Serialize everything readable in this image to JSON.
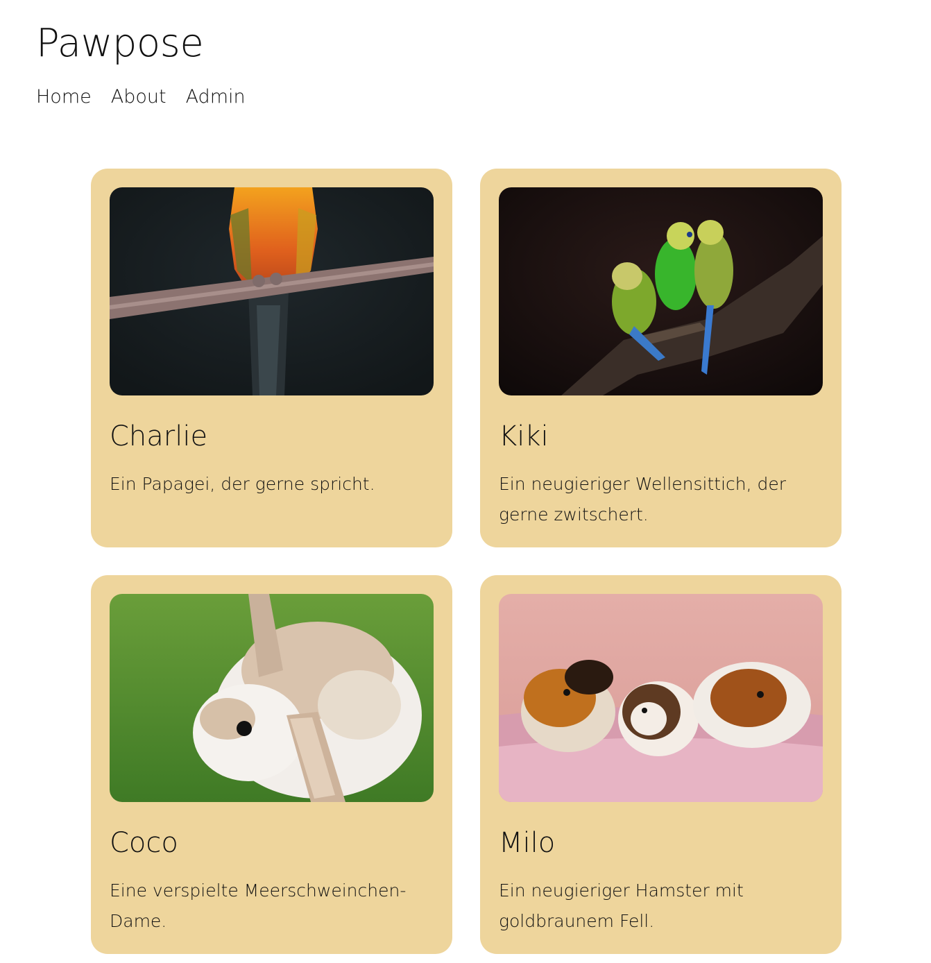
{
  "header": {
    "title": "Pawpose",
    "nav": [
      "Home",
      "About",
      "Admin"
    ]
  },
  "pets": [
    {
      "name": "Charlie",
      "description": "Ein Papagei, der gerne spricht.",
      "photo_icon": "parrot-photo"
    },
    {
      "name": "Kiki",
      "description": "Ein neugieriger Wellensittich, der gerne zwitschert.",
      "photo_icon": "budgies-photo"
    },
    {
      "name": "Coco",
      "description": "Eine verspielte Meerschweinchen-Dame.",
      "photo_icon": "rabbit-photo"
    },
    {
      "name": "Milo",
      "description": "Ein neugieriger Hamster mit goldbraunem Fell.",
      "photo_icon": "guinea-pigs-photo"
    }
  ],
  "colors": {
    "card_background": "#eed59c",
    "text": "#111111",
    "page_background": "#ffffff"
  }
}
